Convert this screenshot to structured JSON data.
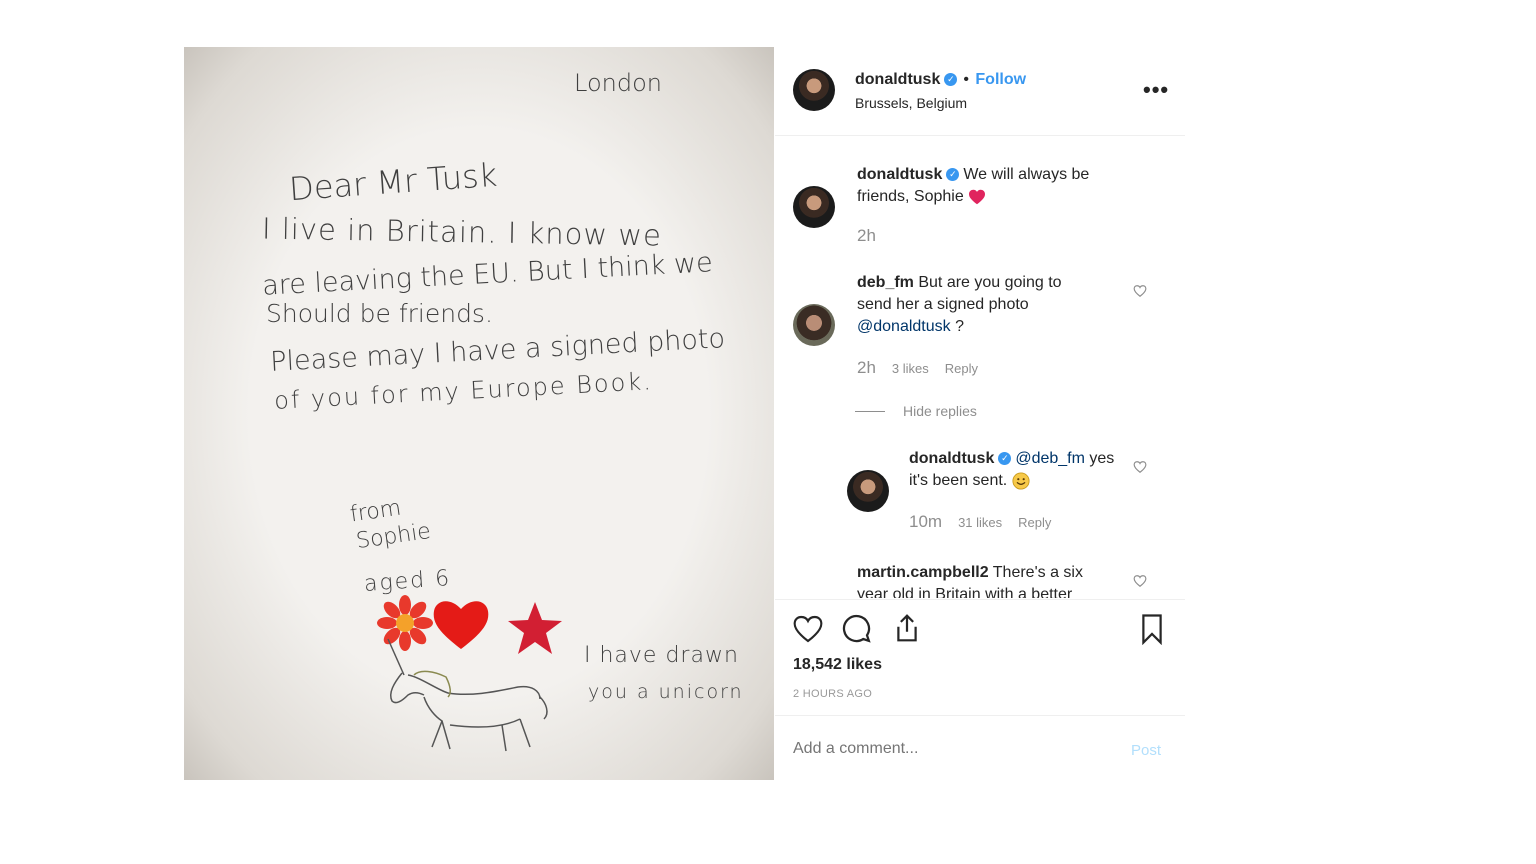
{
  "post": {
    "username": "donaldtusk",
    "follow_label": "Follow",
    "location": "Brussels, Belgium",
    "more_label": "•••"
  },
  "letter": {
    "city": "London",
    "greeting": "Dear Mr Tusk",
    "line1": "I live in Britain. I know we",
    "line2": "are leaving the EU. But I think we",
    "line3": "Should be friends.",
    "line4": "Please may I have a signed photo",
    "line5": "of you for my Europe Book.",
    "from1": "from",
    "from2": "Sophie",
    "aged": "aged 6",
    "drawn1": "I have drawn",
    "drawn2": "you a unicorn"
  },
  "comments": [
    {
      "username": "donaldtusk",
      "text": "We will always be friends, Sophie",
      "time": "2h"
    },
    {
      "username": "deb_fm",
      "text": "But are you going to send her a signed photo",
      "mention": "@donaldtusk",
      "suffix": " ?",
      "time": "2h",
      "likes": "3 likes",
      "reply": "Reply"
    },
    {
      "hide_replies": "Hide replies"
    },
    {
      "username": "donaldtusk",
      "mention": "@deb_fm",
      "text": "yes it's been sent.",
      "time": "10m",
      "likes": "31 likes",
      "reply": "Reply"
    },
    {
      "username": "martin.campbell2",
      "text": "There's a six year old in Britain with a better"
    }
  ],
  "stats": {
    "likes": "18,542 likes",
    "ago": "2 HOURS AGO"
  },
  "composer": {
    "placeholder": "Add a comment...",
    "post_label": "Post"
  },
  "colors": {
    "accent": "#3897f0",
    "heart": "#ed4956",
    "post_disabled": "#b2dffc"
  }
}
